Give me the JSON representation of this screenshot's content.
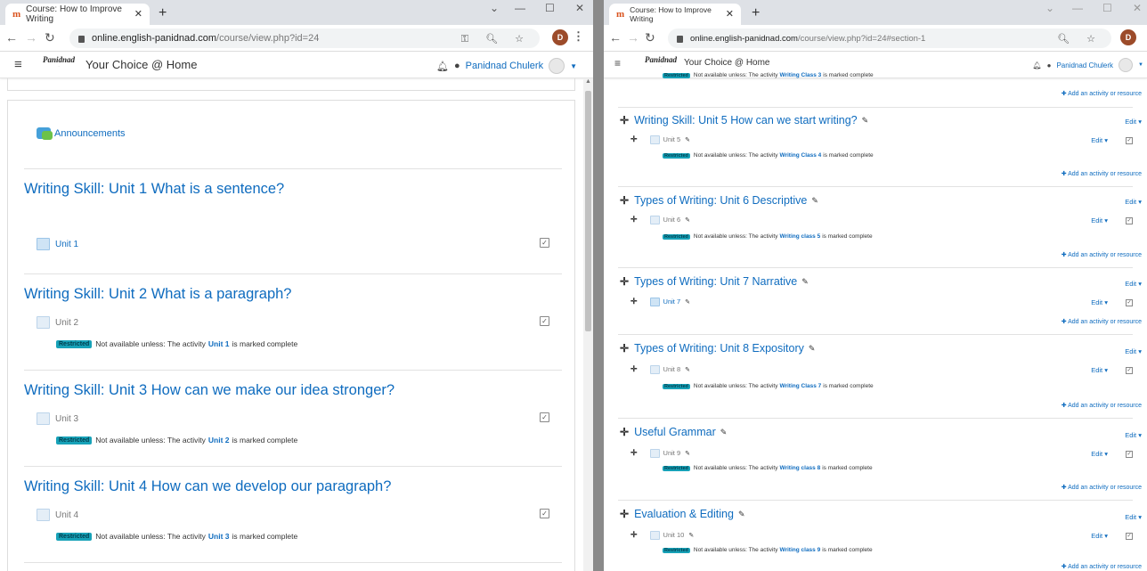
{
  "left": {
    "tab_title": "Course: How to Improve Writing",
    "url_host": "online.english-panidnad.com",
    "url_path": "/course/view.php?id=24",
    "site_name": "Your Choice @ Home",
    "user_name": "Panidnad Chulerk",
    "profile_letter": "D",
    "announcements": "Announcements",
    "restricted_badge": "Restricted",
    "restricted_prefix": "Not available unless: The activity",
    "restricted_suffix": "is marked complete",
    "sections": [
      {
        "title": "Writing Skill: Unit 1 What is a sentence?",
        "activity": "Unit 1",
        "requires": ""
      },
      {
        "title": "Writing Skill: Unit 2 What is a paragraph?",
        "activity": "Unit 2",
        "requires": "Unit 1"
      },
      {
        "title": "Writing Skill: Unit 3 How can we make our idea stronger?",
        "activity": "Unit 3",
        "requires": "Unit 2"
      },
      {
        "title": "Writing Skill: Unit 4 How can we develop our paragraph?",
        "activity": "Unit 4",
        "requires": "Unit 3"
      }
    ]
  },
  "right": {
    "tab_title": "Course: How to Improve Writing",
    "url_host": "online.english-panidnad.com",
    "url_path": "/course/view.php?id=24#section-1",
    "site_name": "Your Choice @ Home",
    "user_name": "Panidnad Chulerk",
    "profile_letter": "D",
    "edit_label": "Edit",
    "add_label": "Add an activity or resource",
    "restricted_badge": "Restricted",
    "restricted_prefix": "Not available unless: The activity",
    "restricted_suffix": "is marked complete",
    "top_requires": "Writing Class 3",
    "sections": [
      {
        "title": "Writing Skill: Unit 5 How can we start writing?",
        "activity": "Unit 5",
        "requires": "Writing Class 4"
      },
      {
        "title": "Types of Writing: Unit 6 Descriptive",
        "activity": "Unit 6",
        "requires": "Writing class 5"
      },
      {
        "title": "Types of Writing: Unit 7 Narrative",
        "activity": "Unit 7",
        "requires": ""
      },
      {
        "title": "Types of Writing: Unit 8 Expository",
        "activity": "Unit 8",
        "requires": "Writing Class 7"
      },
      {
        "title": "Useful Grammar",
        "activity": "Unit 9",
        "requires": "Writing class 8"
      },
      {
        "title": "Evaluation & Editing",
        "activity": "Unit 10",
        "requires": "Writing class 9"
      }
    ]
  }
}
